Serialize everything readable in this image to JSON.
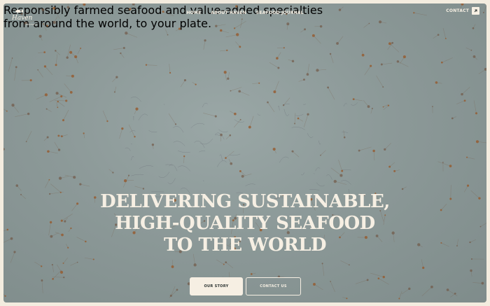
{
  "brand": {
    "name": "Haven",
    "tagline": "SEAFOOD"
  },
  "nav": {
    "items": [
      {
        "label": "HOME"
      },
      {
        "label": "ABOUT HAVEN"
      },
      {
        "label": "SEAFOOD JOURNAL"
      }
    ],
    "contact_label": "CONTACT"
  },
  "hero": {
    "title_lines": [
      "DELIVERING SUSTAINABLE,",
      "HIGH-QUALITY SEAFOOD",
      "TO THE WORLD"
    ],
    "subtitle_lines": [
      "Responsibly farmed seafood and value-added specialties",
      "from around the world, to your plate."
    ],
    "primary_button": "OUR STORY",
    "secondary_button": "CONTACT US"
  },
  "colors": {
    "background": "#8c9998",
    "text": "#f6efe3",
    "page": "#f3ecdf",
    "button_text": "#2d3533"
  },
  "icons": {
    "contact": "arrow-icon",
    "logo": "fish-icon"
  }
}
